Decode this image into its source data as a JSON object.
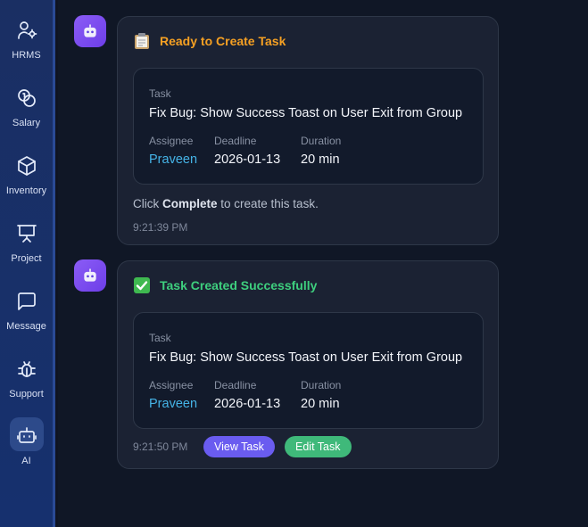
{
  "sidebar": {
    "items": [
      {
        "label": "HRMS",
        "icon": "user-settings-icon"
      },
      {
        "label": "Salary",
        "icon": "coins-icon"
      },
      {
        "label": "Inventory",
        "icon": "box-icon"
      },
      {
        "label": "Project",
        "icon": "presentation-icon"
      },
      {
        "label": "Message",
        "icon": "message-icon"
      },
      {
        "label": "Support",
        "icon": "bug-icon"
      },
      {
        "label": "AI",
        "icon": "robot-icon"
      }
    ],
    "active": "AI"
  },
  "messages": [
    {
      "icon": "clipboard-icon",
      "heading": "Ready to Create Task",
      "task": {
        "task_label": "Task",
        "title": "Fix Bug: Show Success Toast on User Exit from Group",
        "assignee_label": "Assignee",
        "assignee": "Praveen",
        "deadline_label": "Deadline",
        "deadline": "2026-01-13",
        "duration_label": "Duration",
        "duration": "20 min"
      },
      "note_prefix": "Click ",
      "note_bold": "Complete",
      "note_suffix": " to create this task.",
      "time": "9:21:39 PM"
    },
    {
      "icon": "check-box-icon",
      "heading": "Task Created Successfully",
      "task": {
        "task_label": "Task",
        "title": "Fix Bug: Show Success Toast on User Exit from Group",
        "assignee_label": "Assignee",
        "assignee": "Praveen",
        "deadline_label": "Deadline",
        "deadline": "2026-01-13",
        "duration_label": "Duration",
        "duration": "20 min"
      },
      "time": "9:21:50 PM",
      "view_button": "View Task",
      "edit_button": "Edit Task"
    }
  ],
  "colors": {
    "sidebar_bg": "#1a2f63",
    "accent_orange": "#f5a023",
    "accent_green": "#3ecf7e",
    "link_blue": "#45b3e6",
    "view_button": "#6a5cf0",
    "edit_button": "#3fb97a",
    "avatar_purple": "#8b5cf6"
  }
}
